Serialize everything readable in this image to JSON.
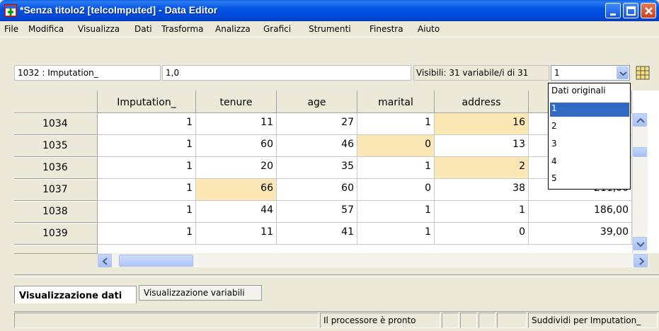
{
  "window": {
    "title": "*Senza titolo2 [telcoImputed] - Data Editor"
  },
  "menu": [
    "File",
    "Modifica",
    "Visualizza",
    "Dati",
    "Trasforma",
    "Analizza",
    "Grafici",
    "Strumenti",
    "Finestra",
    "Aiuto"
  ],
  "cell_editor": {
    "reference": "1032 : Imputation_",
    "value": "1,0",
    "visible_label": "Visibili: 31 variabile/i di 31",
    "combo_value": "1"
  },
  "dropdown": {
    "options": [
      "Dati originali",
      "1",
      "2",
      "3",
      "4",
      "5"
    ],
    "selected": "1"
  },
  "grid": {
    "columns": [
      "Imputation_",
      "tenure",
      "age",
      "marital",
      "address",
      ""
    ],
    "rows": [
      {
        "id": "1034",
        "cells": [
          "1",
          "11",
          "27",
          "1",
          "16",
          ""
        ]
      },
      {
        "id": "1035",
        "cells": [
          "1",
          "60",
          "46",
          "0",
          "13",
          ""
        ]
      },
      {
        "id": "1036",
        "cells": [
          "1",
          "20",
          "35",
          "1",
          "2",
          ""
        ]
      },
      {
        "id": "1037",
        "cells": [
          "1",
          "66",
          "60",
          "0",
          "38",
          "211,00"
        ]
      },
      {
        "id": "1038",
        "cells": [
          "1",
          "44",
          "57",
          "1",
          "1",
          "186,00"
        ]
      },
      {
        "id": "1039",
        "cells": [
          "1",
          "11",
          "41",
          "1",
          "0",
          "39,00"
        ]
      }
    ],
    "imputed_highlight_color": "#fbe8b4"
  },
  "tabs": {
    "data_view": "Visualizzazione dati",
    "variable_view": "Visualizzazione variabili"
  },
  "status": {
    "processor": "Il processore è pronto",
    "split": "Suddividi per Imputation_"
  }
}
